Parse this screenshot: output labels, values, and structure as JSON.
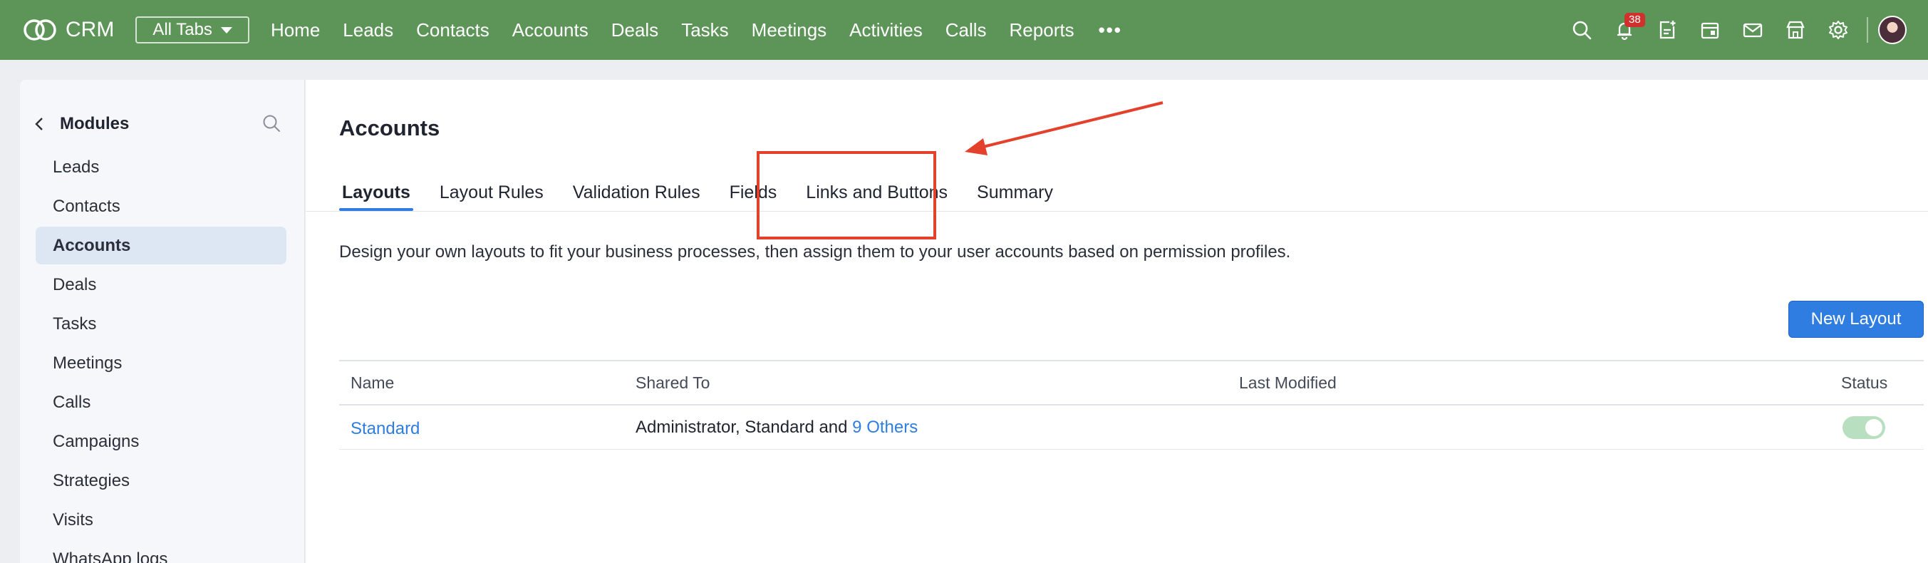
{
  "topbar": {
    "logo_text": "CRM",
    "all_tabs_label": "All Tabs",
    "nav_items": [
      "Home",
      "Leads",
      "Contacts",
      "Accounts",
      "Deals",
      "Tasks",
      "Meetings",
      "Activities",
      "Calls",
      "Reports"
    ],
    "more_label": "•••",
    "notification_count": "38",
    "bar_color": "#5d9559",
    "icons": [
      "search-icon",
      "bell-icon",
      "add-note-icon",
      "calendar-icon",
      "mail-icon",
      "marketplace-icon",
      "gear-icon",
      "avatar"
    ]
  },
  "sidebar": {
    "title": "Modules",
    "items": [
      "Leads",
      "Contacts",
      "Accounts",
      "Deals",
      "Tasks",
      "Meetings",
      "Calls",
      "Campaigns",
      "Strategies",
      "Visits",
      "WhatsApp logs"
    ],
    "active_item": "Accounts"
  },
  "main": {
    "title": "Accounts",
    "tabs": [
      "Layouts",
      "Layout Rules",
      "Validation Rules",
      "Fields",
      "Links and Buttons",
      "Summary"
    ],
    "active_tab": "Layouts",
    "description": "Design your own layouts to fit your business processes, then assign them to your user accounts based on permission profiles.",
    "new_layout_label": "New Layout",
    "accent_color": "#2f7de1",
    "table": {
      "headers": {
        "name": "Name",
        "shared_to": "Shared To",
        "last_modified": "Last Modified",
        "status": "Status"
      },
      "rows": [
        {
          "name": "Standard",
          "shared_to_text": "Administrator, Standard and ",
          "shared_to_link": "9 Others",
          "last_modified": "",
          "status_enabled": true
        }
      ]
    }
  },
  "annotation": {
    "highlighted_tab": "Links and Buttons",
    "color": "#e4412c"
  }
}
